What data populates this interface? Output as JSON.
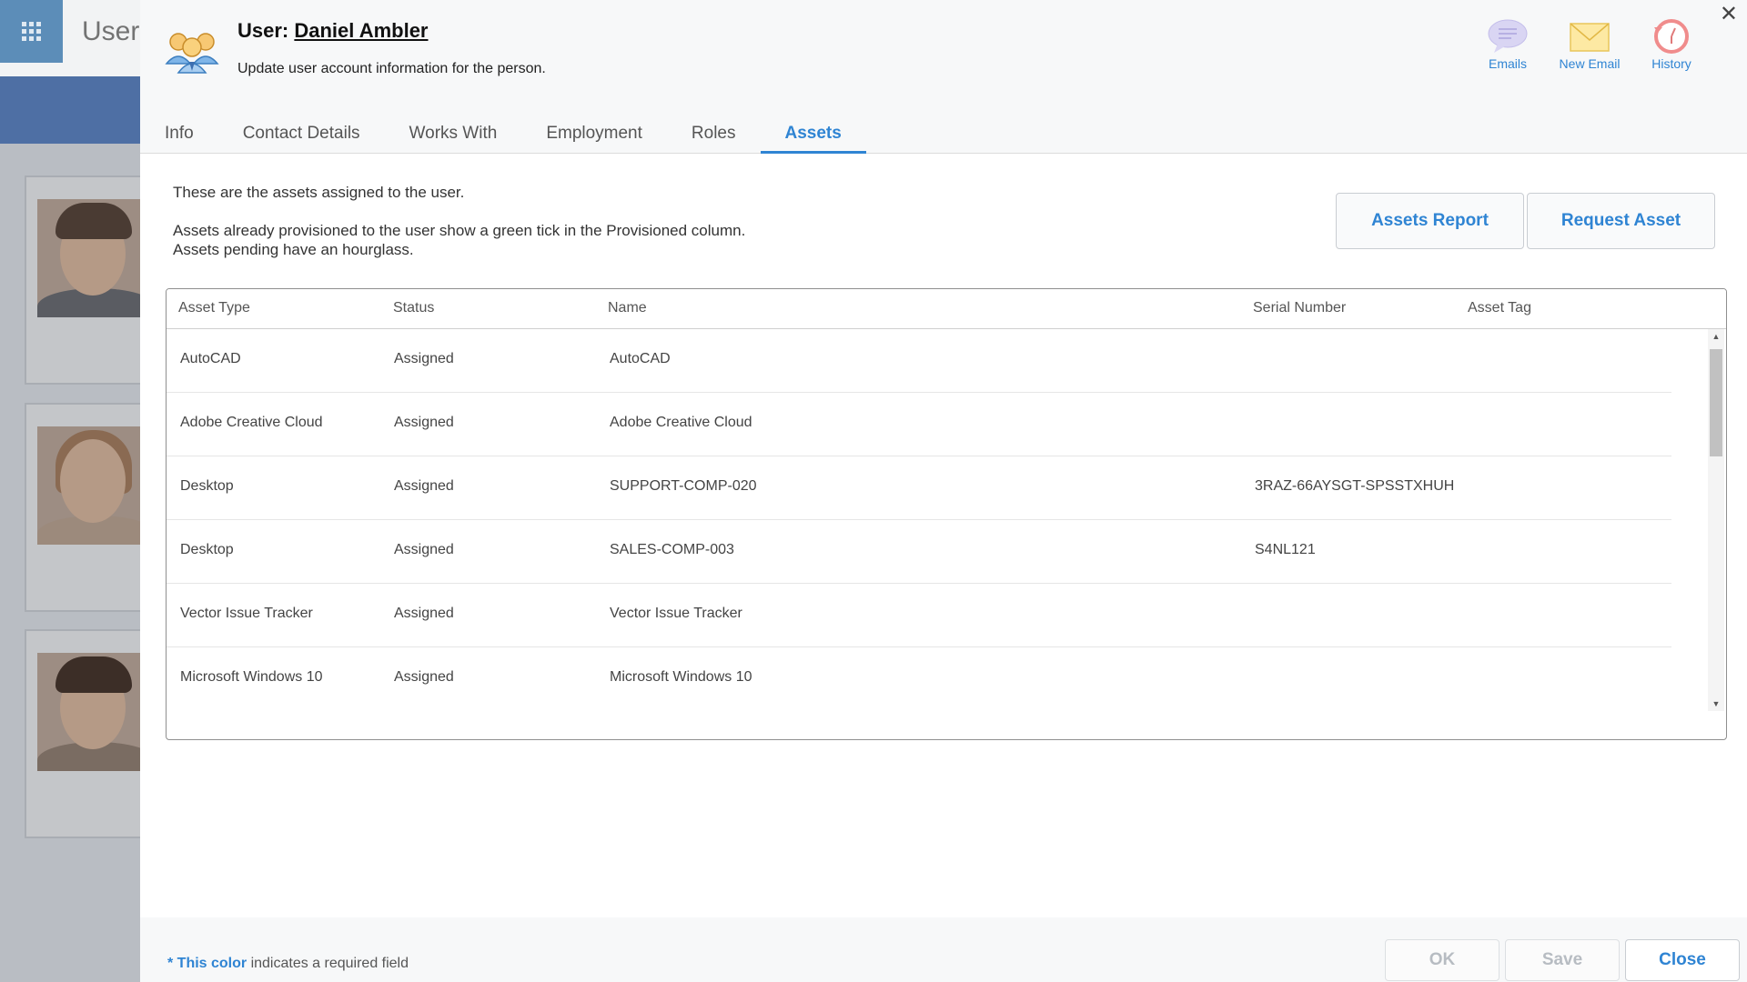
{
  "background": {
    "page_title": "User"
  },
  "modal": {
    "title_prefix": "User:",
    "user_name": "Daniel Ambler",
    "subtitle": "Update user account information for the person.",
    "close_glyph": "✕",
    "tools": [
      {
        "label": "Emails",
        "icon": "chat-bubble-icon"
      },
      {
        "label": "New Email",
        "icon": "envelope-icon"
      },
      {
        "label": "History",
        "icon": "history-clock-icon"
      }
    ],
    "tabs": [
      {
        "label": "Info"
      },
      {
        "label": "Contact Details"
      },
      {
        "label": "Works With"
      },
      {
        "label": "Employment"
      },
      {
        "label": "Roles"
      },
      {
        "label": "Assets",
        "active": true
      }
    ],
    "intro_line1": "These are the assets assigned to the user.",
    "intro_line2": "Assets already provisioned to the user show a green tick in the Provisioned column.",
    "intro_line3": "Assets pending have an hourglass.",
    "buttons": {
      "assets_report": "Assets Report",
      "request_asset": "Request Asset"
    },
    "table": {
      "headers": [
        "Asset Type",
        "Status",
        "Name",
        "Serial Number",
        "Asset Tag"
      ],
      "rows": [
        [
          "AutoCAD",
          "Assigned",
          "AutoCAD",
          "",
          ""
        ],
        [
          "Adobe Creative Cloud",
          "Assigned",
          "Adobe Creative Cloud",
          "",
          ""
        ],
        [
          "Desktop",
          "Assigned",
          "SUPPORT-COMP-020",
          "3RAZ-66AYSGT-SPSSTXHUH",
          ""
        ],
        [
          "Desktop",
          "Assigned",
          "SALES-COMP-003",
          "S4NL121",
          ""
        ],
        [
          "Vector Issue Tracker",
          "Assigned",
          "Vector Issue Tracker",
          "",
          ""
        ],
        [
          "Microsoft Windows 10",
          "Assigned",
          "Microsoft Windows 10",
          "",
          ""
        ]
      ]
    },
    "footer": {
      "req_marker": "* This color",
      "req_text": " indicates a required field",
      "ok": "OK",
      "save": "Save",
      "close": "Close"
    }
  },
  "colors": {
    "accent": "#2f84d3",
    "overlay": "#b9bdc3",
    "band": "#4e6fa4"
  }
}
